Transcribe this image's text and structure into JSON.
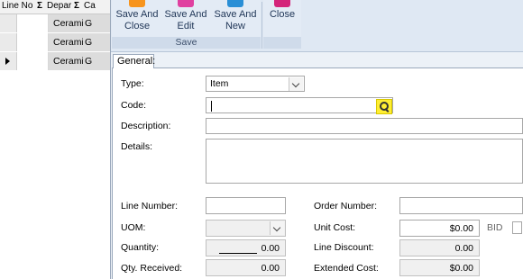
{
  "grid": {
    "headers": {
      "line_no": "Line No",
      "sigma": "Σ",
      "dept": "Depar",
      "cat": "Ca"
    },
    "rows": [
      {
        "dept": "Cerami",
        "cat": "G"
      },
      {
        "dept": "Cerami",
        "cat": "G"
      },
      {
        "dept": "Cerami",
        "cat": "G"
      }
    ]
  },
  "ribbon": {
    "save_close": "Save And Close",
    "save_edit": "Save And Edit",
    "save_new": "Save And New",
    "close": "Close",
    "group_save": "Save",
    "colors": {
      "save_close": "#f7941d",
      "save_edit": "#e040a0",
      "save_new": "#2a8fd6",
      "close": "#d4247a"
    }
  },
  "tabs": {
    "general": "General:"
  },
  "form": {
    "type_label": "Type:",
    "type_value": "Item",
    "code_label": "Code:",
    "code_value": "",
    "description_label": "Description:",
    "details_label": "Details:",
    "line_number_label": "Line Number:",
    "order_number_label": "Order Number:",
    "uom_label": "UOM:",
    "unit_cost_label": "Unit Cost:",
    "unit_cost_value": "$0.00",
    "bid_label": "BID",
    "quantity_label": "Quantity:",
    "quantity_value": "0.00",
    "line_discount_label": "Line Discount:",
    "line_discount_value": "0.00",
    "qty_received_label": "Qty. Received:",
    "qty_received_value": "0.00",
    "extended_cost_label": "Extended Cost:",
    "extended_cost_value": "$0.00"
  }
}
